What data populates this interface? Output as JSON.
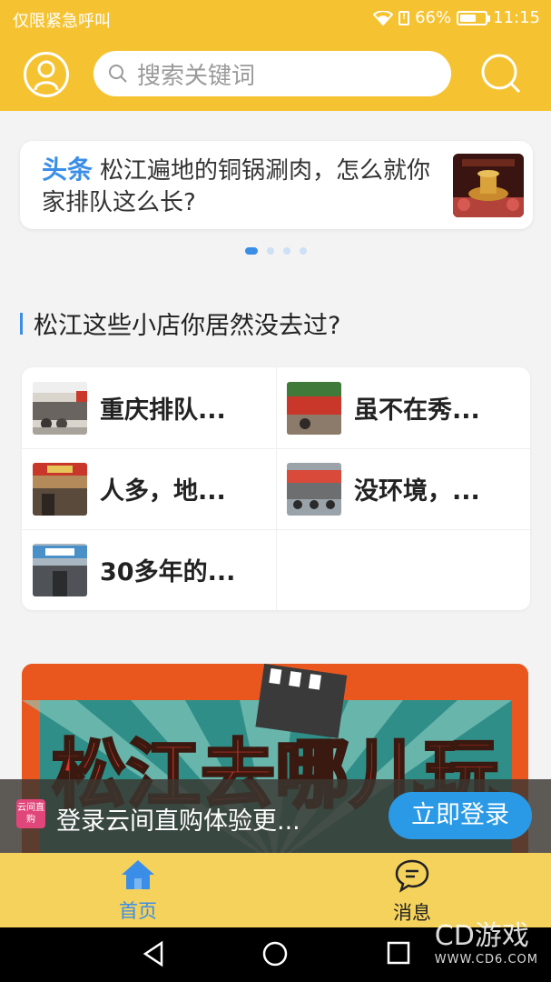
{
  "status_bar": {
    "carrier_text": "仅限紧急呼叫",
    "battery": "66%",
    "battery_level": 0.66,
    "time": "11:15"
  },
  "header": {
    "search_placeholder": "搜索关键词",
    "icons": [
      "user-icon",
      "search-icon"
    ]
  },
  "headline": {
    "tag": "头条",
    "text": "松江遍地的铜锅涮肉，怎么就你家排队这么长?",
    "carousel_pages": 4,
    "active_page": 1
  },
  "section": {
    "title": "松江这些小店你居然没去过?"
  },
  "shops": [
    {
      "name": "重庆排队..."
    },
    {
      "name": "虽不在秀..."
    },
    {
      "name": "人多，地..."
    },
    {
      "name": "没环境，..."
    },
    {
      "name": "30多年的..."
    }
  ],
  "banner": {
    "text": "松江去哪儿玩"
  },
  "login_prompt": {
    "logo_text": "云间直购",
    "message": "登录云间直购体验更...",
    "button": "立即登录"
  },
  "bottom_nav": {
    "home": "首页",
    "messages": "消息"
  },
  "watermark": {
    "brand": "CD游戏",
    "url": "WWW.CD6.COM"
  },
  "colors": {
    "header_yellow": "#f5c332",
    "accent_blue": "#3b8ee8",
    "nav_yellow": "#f5d25c"
  }
}
